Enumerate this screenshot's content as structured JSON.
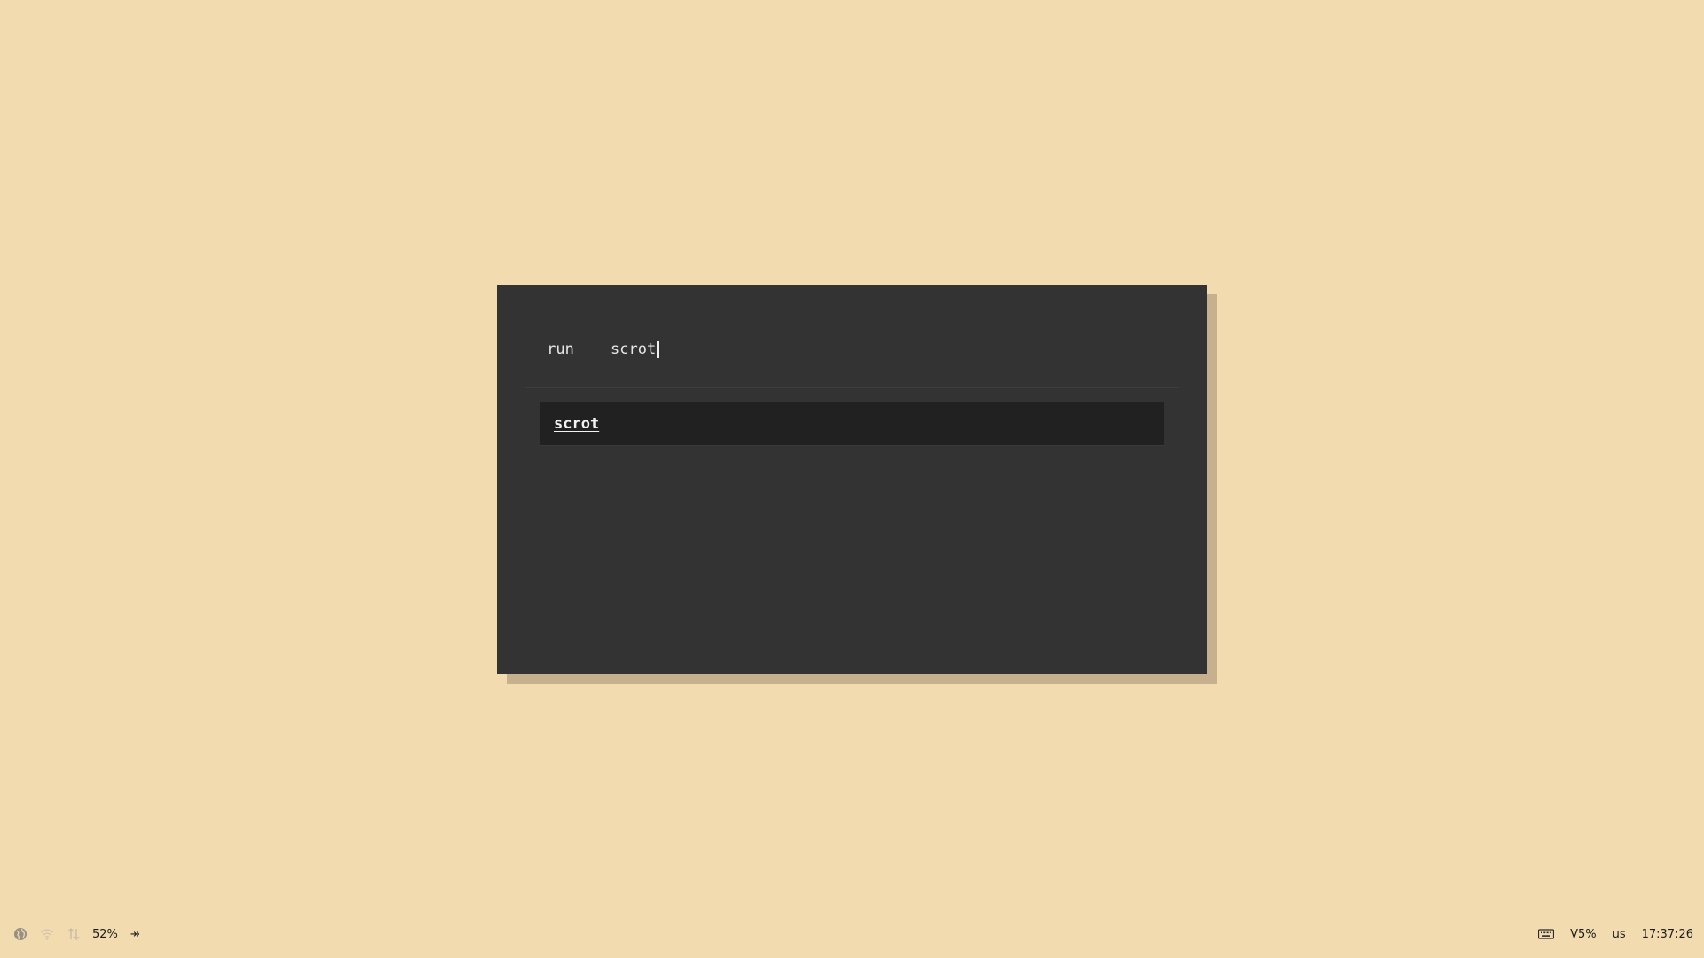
{
  "launcher": {
    "mode_label": "run",
    "query": "scrot",
    "results": [
      {
        "label": "scrot"
      }
    ]
  },
  "panel": {
    "left": {
      "icons": [
        "globe-icon",
        "wifi-icon",
        "network-icon"
      ],
      "battery": "52%",
      "battery_status_glyph": "↠"
    },
    "right": {
      "keyboard_icon": "keyboard-icon",
      "volume": "V5%",
      "layout": "us",
      "clock": "17:37:26"
    }
  }
}
